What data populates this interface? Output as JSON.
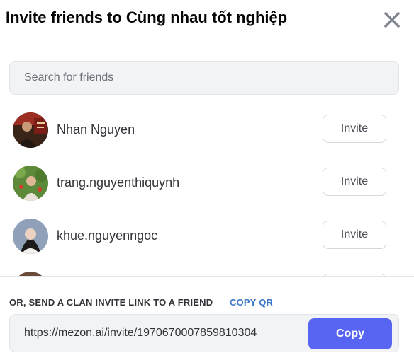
{
  "dialog": {
    "title": "Invite friends to Cùng nhau tốt nghiệp",
    "close_icon": "close-icon"
  },
  "search": {
    "placeholder": "Search for friends",
    "value": ""
  },
  "friends": [
    {
      "name": "Nhan Nguyen",
      "invite_label": "Invite"
    },
    {
      "name": "trang.nguyenthiquynh",
      "invite_label": "Invite"
    },
    {
      "name": "khue.nguyenngoc",
      "invite_label": "Invite"
    },
    {
      "name": "",
      "invite_label": ""
    }
  ],
  "footer": {
    "label": "OR, SEND A CLAN INVITE LINK TO A FRIEND",
    "copy_qr_label": "COPY QR",
    "invite_link": "https://mezon.ai/invite/1970670007859810304",
    "copy_label": "Copy"
  },
  "colors": {
    "accent": "#5865f2",
    "link": "#3c78c8",
    "field_bg": "#f2f3f5"
  }
}
